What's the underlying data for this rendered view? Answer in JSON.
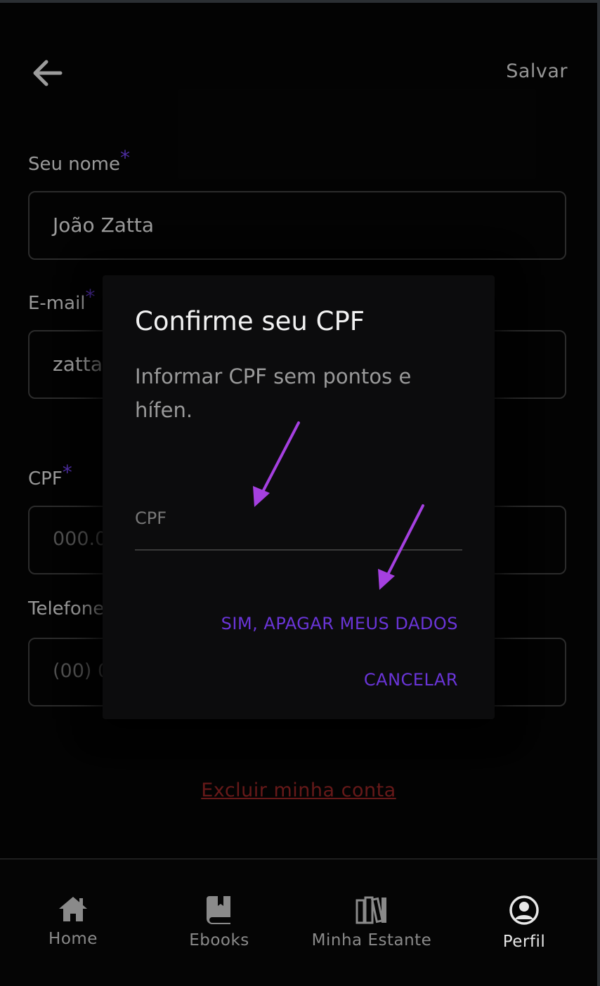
{
  "header": {
    "save_label": "Salvar"
  },
  "form": {
    "name_label": "Seu nome",
    "name_value": "João Zatta",
    "email_label": "E-mail",
    "email_value": "zatta",
    "cpf_label": "CPF",
    "cpf_placeholder": "000.0",
    "phone_label": "Telefone",
    "phone_placeholder": "(00) 0",
    "required_mark": "*"
  },
  "delete_account_label": "Excluir minha conta",
  "dialog": {
    "title": "Confirme seu CPF",
    "message": "Informar CPF sem pontos e hífen.",
    "cpf_input_placeholder": "CPF",
    "confirm_label": "SIM, APAGAR MEUS DADOS",
    "cancel_label": "CANCELAR"
  },
  "bottom_nav": {
    "items": [
      {
        "label": "Home",
        "icon": "home-icon"
      },
      {
        "label": "Ebooks",
        "icon": "book-icon"
      },
      {
        "label": "Minha Estante",
        "icon": "bookshelf-icon"
      },
      {
        "label": "Perfil",
        "icon": "user-circle-icon",
        "active": true
      }
    ]
  },
  "colors": {
    "accent": "#6a35d8",
    "danger": "#8e2323",
    "annotation_arrow": "#a540e0",
    "background": "#050505"
  }
}
